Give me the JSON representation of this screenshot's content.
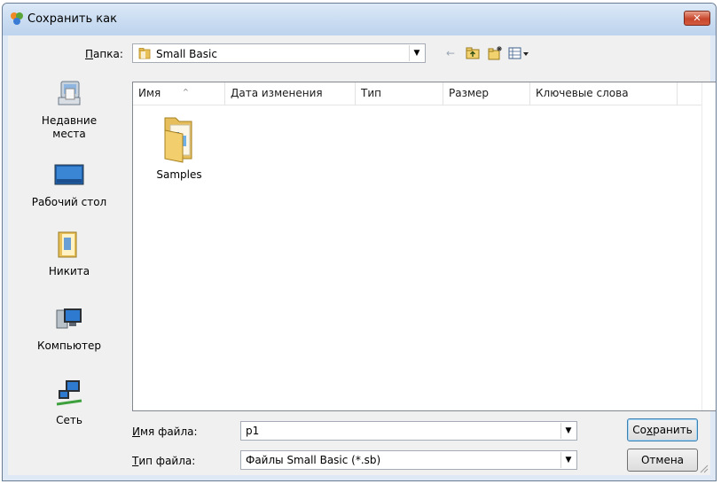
{
  "window": {
    "title": "Сохранить как",
    "close_glyph": "✕"
  },
  "folder": {
    "label": "Папка:",
    "label_hotkey": "П",
    "label_rest": "апка:",
    "current": "Small Basic"
  },
  "places": [
    {
      "name": "recent",
      "label_line1": "Недавние",
      "label_line2": "места",
      "icon": "recent-places-icon"
    },
    {
      "name": "desktop",
      "label_line1": "Рабочий стол",
      "label_line2": "",
      "icon": "desktop-icon"
    },
    {
      "name": "user",
      "label_line1": "Никита",
      "label_line2": "",
      "icon": "user-folder-icon"
    },
    {
      "name": "computer",
      "label_line1": "Компьютер",
      "label_line2": "",
      "icon": "computer-icon"
    },
    {
      "name": "network",
      "label_line1": "Сеть",
      "label_line2": "",
      "icon": "network-icon"
    }
  ],
  "columns": [
    "Имя",
    "Дата изменения",
    "Тип",
    "Размер",
    "Ключевые слова"
  ],
  "files": [
    {
      "name": "Samples",
      "icon": "folder-icon"
    }
  ],
  "filename": {
    "label": "Имя файла:",
    "hotkey": "И",
    "rest": "мя файла:",
    "value": "p1"
  },
  "filetype": {
    "label": "Тип файла:",
    "hotkey": "Т",
    "rest": "ип файла:",
    "value": "Файлы Small Basic (*.sb)"
  },
  "buttons": {
    "save": "Сохранить",
    "save_pre": "Со",
    "save_hot": "х",
    "save_post": "ранить",
    "cancel": "Отмена"
  },
  "colors": {
    "titlebar": "#c9dcf1",
    "client": "#f0f0f0",
    "close": "#c8472d"
  }
}
